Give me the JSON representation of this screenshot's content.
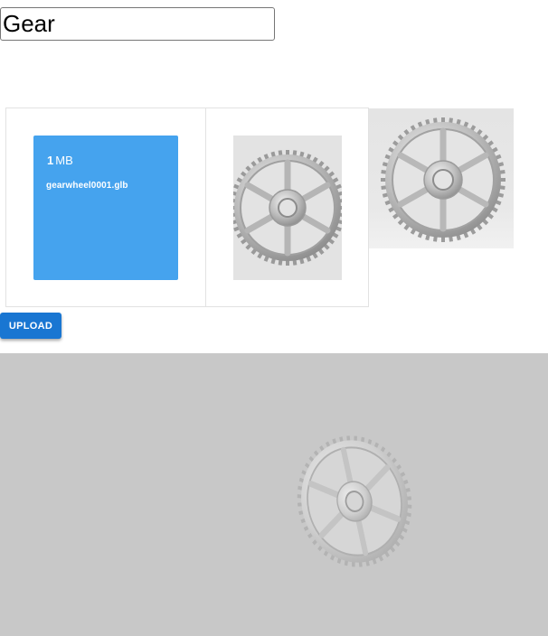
{
  "form": {
    "name_value": "Gear"
  },
  "file_card": {
    "size_number": "1",
    "size_unit": "MB",
    "file_name": "gearwheel0001.glb"
  },
  "upload": {
    "label": "UPLOAD"
  },
  "colors": {
    "primary_button": "#1976d2",
    "file_card": "#45a3ee",
    "viewer_background": "#c8c8c8"
  },
  "icons": [
    "gear-thumbnail-icon",
    "gear-preview-icon",
    "gear-3d-model"
  ]
}
